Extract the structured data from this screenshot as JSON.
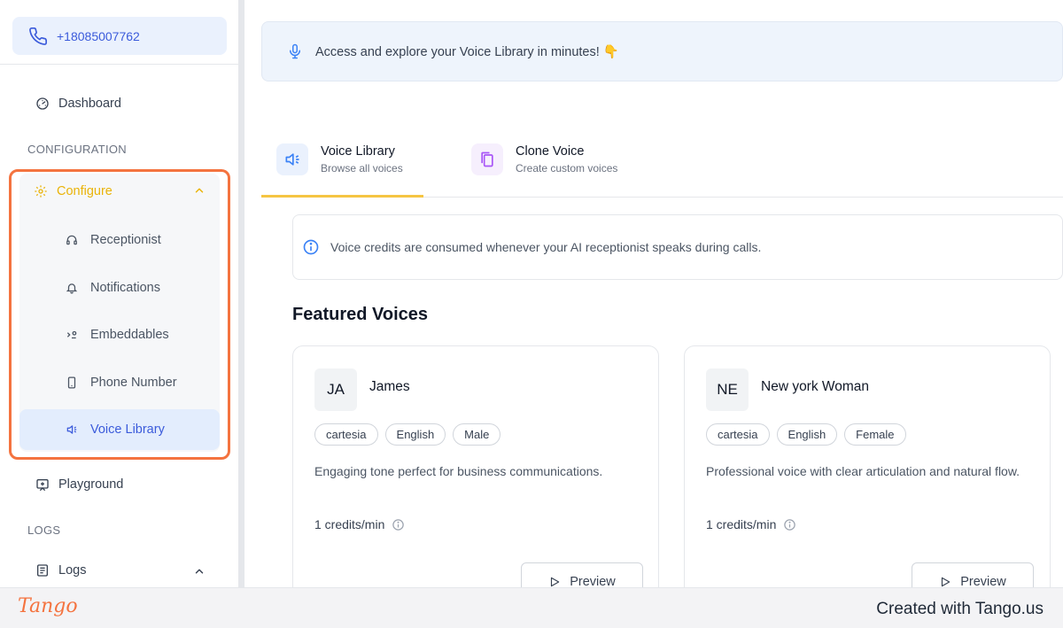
{
  "sidebar": {
    "phone": "+18085007762",
    "dashboard_label": "Dashboard",
    "section_configuration": "CONFIGURATION",
    "configure_label": "Configure",
    "sub_items": [
      {
        "label": "Receptionist",
        "icon": "headset-icon"
      },
      {
        "label": "Notifications",
        "icon": "bell-icon"
      },
      {
        "label": "Embeddables",
        "icon": "embed-icon"
      },
      {
        "label": "Phone Number",
        "icon": "smartphone-icon"
      },
      {
        "label": "Voice Library",
        "icon": "speaker-icon"
      }
    ],
    "playground_label": "Playground",
    "section_logs": "LOGS",
    "logs_label": "Logs"
  },
  "banner": {
    "text": "Access and explore your Voice Library in minutes! 👇"
  },
  "tabs": [
    {
      "title": "Voice Library",
      "subtitle": "Browse all voices",
      "active": true
    },
    {
      "title": "Clone Voice",
      "subtitle": "Create custom voices",
      "active": false
    }
  ],
  "info": {
    "text": "Voice credits are consumed whenever your AI receptionist speaks during calls."
  },
  "featured": {
    "title": "Featured Voices",
    "voices": [
      {
        "initials": "JA",
        "name": "James",
        "tags": [
          "cartesia",
          "English",
          "Male"
        ],
        "description": "Engaging tone perfect for business communications.",
        "credits": "1 credits/min",
        "preview_label": "Preview"
      },
      {
        "initials": "NE",
        "name": "New york Woman",
        "tags": [
          "cartesia",
          "English",
          "Female"
        ],
        "description": "Professional voice with clear articulation and natural flow.",
        "credits": "1 credits/min",
        "preview_label": "Preview"
      }
    ]
  },
  "footer": {
    "logo": "Tango",
    "created_with": "Created with Tango.us"
  },
  "colors": {
    "accent": "#3b5bdb",
    "configure": "#eab308",
    "highlight": "#f4733f",
    "tab_underline": "#f5c542"
  }
}
